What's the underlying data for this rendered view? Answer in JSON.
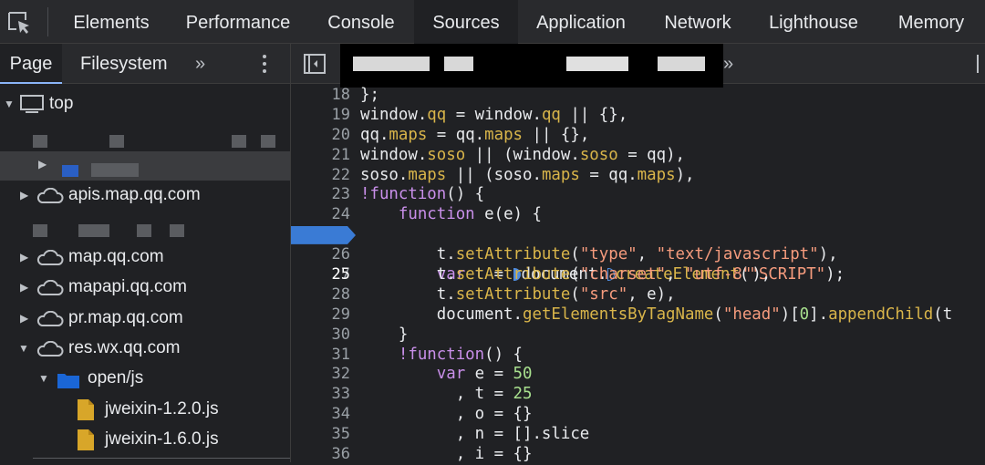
{
  "tabs": [
    "Elements",
    "Performance",
    "Console",
    "Sources",
    "Application",
    "Network",
    "Lighthouse",
    "Memory"
  ],
  "active_tab": "Sources",
  "navigator": {
    "tabs": [
      "Page",
      "Filesystem"
    ],
    "more": "»",
    "tree": {
      "top": "top",
      "domains": [
        "apis.map.qq.com",
        "map.qq.com",
        "mapapi.qq.com",
        "pr.map.qq.com",
        "res.wx.qq.com"
      ],
      "folder": "open/js",
      "files": [
        "jweixin-1.2.0.js",
        "jweixin-1.6.0.js"
      ]
    }
  },
  "editor": {
    "more": "»",
    "breakpoint_line": 25,
    "lines": [
      {
        "n": "18",
        "text": "};"
      },
      {
        "n": "19",
        "text": "window.qq = window.qq || {},"
      },
      {
        "n": "20",
        "text": "qq.maps = qq.maps || {},"
      },
      {
        "n": "21",
        "text": "window.soso || (window.soso = qq),"
      },
      {
        "n": "22",
        "text": "soso.maps || (soso.maps = qq.maps),"
      },
      {
        "n": "23",
        "text": "!function() {"
      },
      {
        "n": "24",
        "text": "    function e(e) {"
      },
      {
        "n": "25",
        "text": "        var t = document.createElement(\"SCRIPT\");"
      },
      {
        "n": "26",
        "text": "        t.setAttribute(\"type\", \"text/javascript\"),"
      },
      {
        "n": "27",
        "text": "        t.setAttribute(\"charset\", \"utf-8\"),"
      },
      {
        "n": "28",
        "text": "        t.setAttribute(\"src\", e),"
      },
      {
        "n": "29",
        "text": "        document.getElementsByTagName(\"head\")[0].appendChild(t"
      },
      {
        "n": "30",
        "text": "    }"
      },
      {
        "n": "31",
        "text": "    !function() {"
      },
      {
        "n": "32",
        "text": "        var e = 50"
      },
      {
        "n": "33",
        "text": "          , t = 25"
      },
      {
        "n": "34",
        "text": "          , o = {}"
      },
      {
        "n": "35",
        "text": "          , n = [].slice"
      },
      {
        "n": "36",
        "text": "          , i = {}"
      }
    ]
  },
  "colors": {
    "accent": "#8ab4f8",
    "breakpoint": "#3a7bd5",
    "keyword": "#c98fea",
    "property": "#d9b54a",
    "string": "#f59b7d",
    "number": "#a8e08e"
  }
}
